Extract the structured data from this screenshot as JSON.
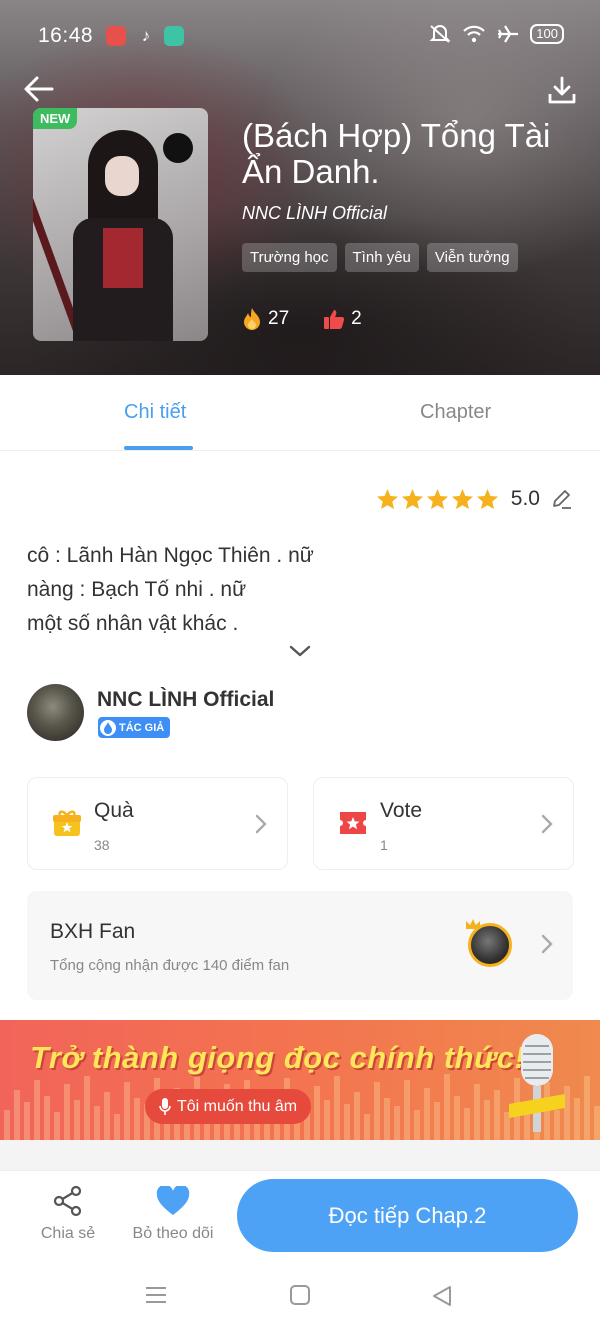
{
  "status_bar": {
    "time": "16:48",
    "battery": "100"
  },
  "book": {
    "badge": "NEW",
    "title": "(Bách Hợp) Tổng Tài Ẩn Danh.",
    "author": "NNC LÌNH Official",
    "tags": [
      "Trường học",
      "Tình yêu",
      "Viễn tưởng"
    ],
    "views": "27",
    "likes": "2"
  },
  "tabs": {
    "detail": "Chi tiết",
    "chapter": "Chapter"
  },
  "rating": {
    "score": "5.0",
    "stars": 5,
    "star_color": "#f5b21e"
  },
  "description": [
    "cô : Lãnh Hàn Ngọc Thiên . nữ",
    "nàng : Bạch Tố nhi . nữ",
    "một số nhân vật khác ."
  ],
  "author_section": {
    "name": "NNC LÌNH Official",
    "badge": "TÁC GIẢ"
  },
  "cards": {
    "gift": {
      "title": "Quà",
      "count": "38"
    },
    "vote": {
      "title": "Vote",
      "count": "1"
    }
  },
  "fan_rank": {
    "title": "BXH Fan",
    "subtitle": "Tổng cộng nhận được 140 điểm fan"
  },
  "banner": {
    "headline": "Trở thành giọng đọc chính thức!",
    "button": "Tôi muốn thu âm"
  },
  "bottom_bar": {
    "share": "Chia sẻ",
    "unfollow": "Bỏ theo dõi",
    "continue": "Đọc tiếp Chap.2"
  },
  "colors": {
    "accent": "#4a9ef0",
    "new_badge": "#3dbb5f",
    "banner": "#f2645a"
  }
}
